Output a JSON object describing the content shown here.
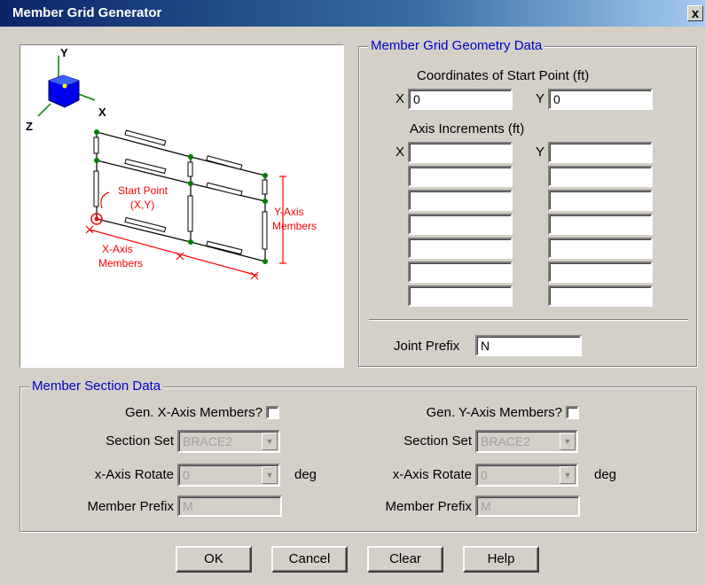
{
  "window": {
    "title": "Member Grid Generator",
    "close_glyph": "x"
  },
  "diagram": {
    "axis_y": "Y",
    "axis_x": "X",
    "axis_z": "Z",
    "start_point_line1": "Start Point",
    "start_point_line2": "(X,Y)",
    "y_members_line1": "Y-Axis",
    "y_members_line2": "Members",
    "x_members_line1": "X-Axis",
    "x_members_line2": "Members",
    "colors": {
      "annotation": "#ff0000",
      "cube": "#0000ee",
      "node": "#008000"
    }
  },
  "geometry": {
    "title": "Member Grid Geometry Data",
    "coords_label": "Coordinates of Start Point  (ft)",
    "x_label": "X",
    "y_label": "Y",
    "start_x": "0",
    "start_y": "0",
    "increments_label": "Axis Increments  (ft)",
    "x_increments": [
      "",
      "",
      "",
      "",
      "",
      "",
      ""
    ],
    "y_increments": [
      "",
      "",
      "",
      "",
      "",
      "",
      ""
    ],
    "joint_prefix_label": "Joint Prefix",
    "joint_prefix": "N"
  },
  "section": {
    "title": "Member Section Data",
    "gen_x_label": "Gen. X-Axis Members?",
    "gen_y_label": "Gen. Y-Axis Members?",
    "gen_x_checked": false,
    "gen_y_checked": false,
    "section_set_label": "Section Set",
    "x_section_set": "BRACE2",
    "y_section_set": "BRACE2",
    "rotate_label": "x-Axis Rotate",
    "x_rotate": "0",
    "y_rotate": "0",
    "deg_label": "deg",
    "member_prefix_label": "Member Prefix",
    "x_member_prefix": "M",
    "y_member_prefix": "M"
  },
  "buttons": {
    "ok": "OK",
    "cancel": "Cancel",
    "clear": "Clear",
    "help": "Help"
  }
}
